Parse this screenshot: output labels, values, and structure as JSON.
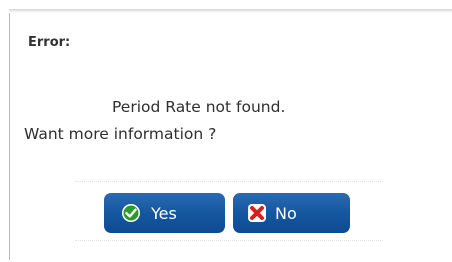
{
  "dialog": {
    "title": "Error:",
    "message_line1": "Period Rate not found.",
    "message_line2": "Want more information ?"
  },
  "buttons": {
    "yes": {
      "label": "Yes",
      "icon": "check-icon"
    },
    "no": {
      "label": "No",
      "icon": "x-icon"
    }
  },
  "colors": {
    "button_bg": "#1557a0",
    "check_green": "#2d9a2d",
    "x_red": "#d62020"
  }
}
